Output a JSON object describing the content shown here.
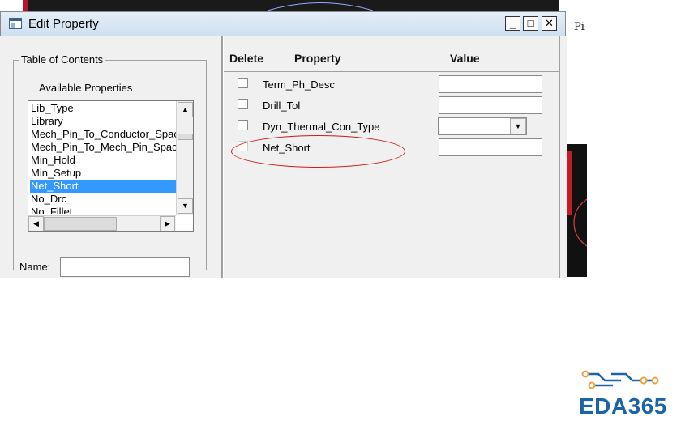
{
  "background": {
    "side_text": "Pi"
  },
  "window": {
    "title": "Edit Property",
    "icons": {
      "app": "window-app-icon",
      "minimize": "minimize-icon",
      "maximize": "maximize-icon",
      "close": "close-icon"
    },
    "buttons": {
      "minimize": "_",
      "maximize": "□",
      "close": "✕"
    }
  },
  "left_panel": {
    "group_title": "Table of Contents",
    "available_label": "Available Properties",
    "list_items": [
      "Lib_Type",
      "Library",
      "Mech_Pin_To_Conductor_Spacing",
      "Mech_Pin_To_Mech_Pin_Spacing",
      "Min_Hold",
      "Min_Setup",
      "Net_Short",
      "No_Drc",
      "No_Fillet"
    ],
    "selected_item": "Net_Short",
    "scroll_arrows": {
      "up": "▲",
      "down": "▼",
      "left": "◀",
      "right": "▶"
    },
    "name_label": "Name:",
    "name_value": ""
  },
  "right_panel": {
    "headers": {
      "delete": "Delete",
      "property": "Property",
      "value": "Value"
    },
    "rows": [
      {
        "property": "Term_Ph_Desc",
        "value": "",
        "control": "text"
      },
      {
        "property": "Drill_Tol",
        "value": "",
        "control": "text"
      },
      {
        "property": "Dyn_Thermal_Con_Type",
        "value": "",
        "control": "select"
      },
      {
        "property": "Net_Short",
        "value": "",
        "control": "text"
      }
    ],
    "dropdown_arrow": "▼",
    "annotation_color": "#c81e1e"
  },
  "logo": {
    "text": "EDA365",
    "color": "#1b64a8",
    "accent": "#e8a23a"
  }
}
